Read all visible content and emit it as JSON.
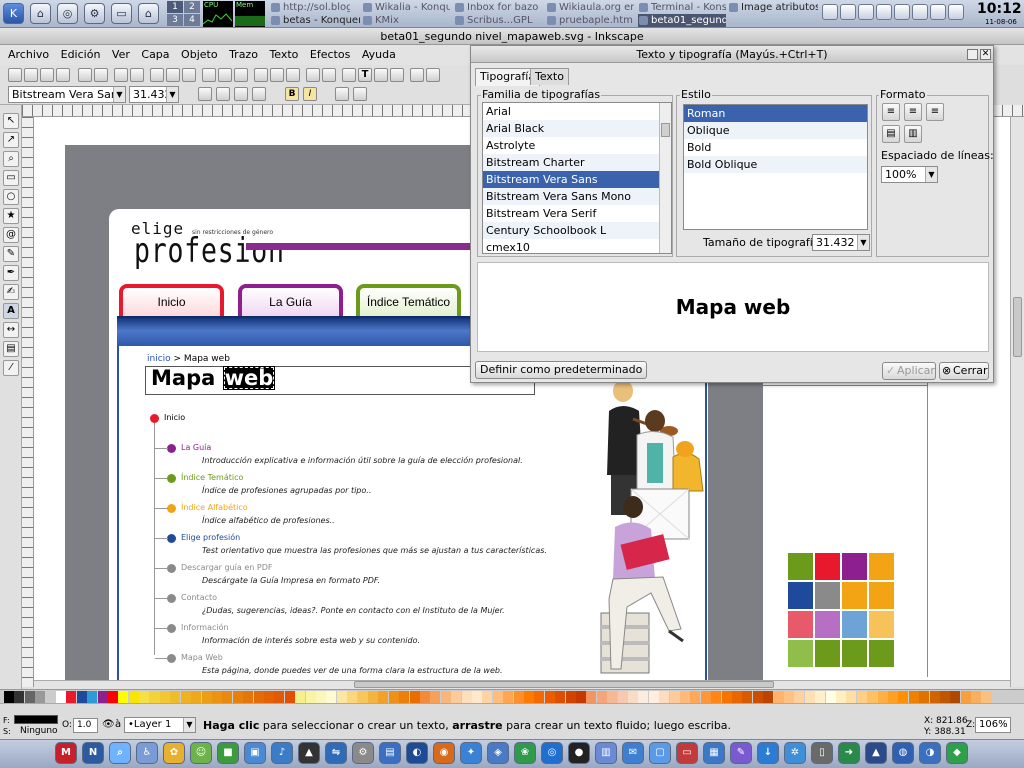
{
  "panel": {
    "tasks": [
      {
        "label": "http://sol.blog",
        "state": "dim"
      },
      {
        "label": "Wikalia - Konqu",
        "state": "dim"
      },
      {
        "label": "Inbox for bazo",
        "state": "dim"
      },
      {
        "label": "Wikiaula.org en",
        "state": "dim"
      },
      {
        "label": "Terminal - Kons",
        "state": "dim"
      },
      {
        "label": "Image atributos",
        "state": "normal"
      },
      {
        "label": "betas - Konquer",
        "state": "normal"
      },
      {
        "label": "KMix",
        "state": "dim"
      },
      {
        "label": "Scribus...GPL",
        "state": "dim"
      },
      {
        "label": "pruebaple.htm",
        "state": "dim"
      },
      {
        "label": "beta01_segundo",
        "state": "active"
      }
    ],
    "monitor_labels": [
      "CPU",
      "Mem"
    ],
    "desktop_numbers": [
      "1",
      "2",
      "3",
      "4"
    ],
    "clock_time": "10:12",
    "clock_date": "11-08-06"
  },
  "window": {
    "title": "beta01_segundo nivel_mapaweb.svg - Inkscape"
  },
  "menus": [
    "Archivo",
    "Edición",
    "Ver",
    "Capa",
    "Objeto",
    "Trazo",
    "Texto",
    "Efectos",
    "Ayuda"
  ],
  "text_toolbar": {
    "font_family": "Bitstream Vera Sans",
    "font_size": "31.432"
  },
  "canvas": {
    "logo_top": "elige",
    "logo_main": "profesion",
    "logo_tagline": "sin restricciones de género",
    "nav_tabs": [
      "Inicio",
      "La Guía",
      "Índice Temático"
    ],
    "breadcrumb_link": "inicio",
    "breadcrumb_rest": " > Mapa web",
    "title_word1": "Mapa",
    "title_word2": "web",
    "tree": [
      {
        "label": "Inicio",
        "color": "#e8192c",
        "desc": ""
      },
      {
        "label": "La Guía",
        "color": "#8e1f8f",
        "desc": "Introducción explicativa e información útil sobre la  guía de elección profesional."
      },
      {
        "label": "Índice Temático",
        "color": "#6c9a1b",
        "desc": "Índice de profesiones agrupadas por tipo.."
      },
      {
        "label": "Índice Alfabético",
        "color": "#f3a415",
        "desc": "Índice alfabético de profesiones.."
      },
      {
        "label": "Elige profesión",
        "color": "#1f4a9c",
        "desc": "Test orientativo que muestra las profesiones que más se ajustan a tus características."
      },
      {
        "label": "Descargar guía en PDF",
        "color": "#8a8a8a",
        "desc": "Descárgate la Guía Impresa en formato PDF."
      },
      {
        "label": "Contacto",
        "color": "#8a8a8a",
        "desc": "¿Dudas, sugerencias, ideas?. Ponte en contacto con el Instituto de la Mujer."
      },
      {
        "label": "Información",
        "color": "#8a8a8a",
        "desc": "Información de interés sobre esta web y su contenido."
      },
      {
        "label": "Mapa Web",
        "color": "#8a8a8a",
        "desc": "Esta página, donde puedes ver de una forma clara la estructura de la web."
      }
    ],
    "squares_colors": [
      "#6c9a1b",
      "#e8192c",
      "#8e1f8f",
      "#f3a415",
      "#1f4a9c",
      "#8a8a8a",
      "#f3a415",
      "#f3a415",
      "#e85a6a",
      "#b76fc5",
      "#6ea3d8",
      "#f7c25a",
      "#8fbf4a",
      "#6c9a1b",
      "#6c9a1b",
      "#6c9a1b"
    ]
  },
  "status": {
    "fill_label": "F:",
    "stroke_label": "S:",
    "stroke_value": "Ninguno",
    "opacity_label": "O:",
    "opacity_value": "1.0",
    "layer": "•Layer 1",
    "msg_b1": "Haga clic",
    "msg_t1": " para seleccionar o crear un texto, ",
    "msg_b2": "arrastre",
    "msg_t2": " para crear un texto fluido; luego escriba.",
    "x_coord": "X: 821.86",
    "y_coord": "Y: 388.31",
    "zoom_label": "Z:",
    "zoom": "106%"
  },
  "dialog": {
    "title": "Texto y tipografía (Mayús.+Ctrl+T)",
    "tabs": [
      "Tipografía",
      "Texto"
    ],
    "family_label": "Familia de tipografías",
    "families": [
      "Arial",
      "Arial Black",
      "Astrolyte",
      "Bitstream Charter",
      "Bitstream Vera Sans",
      "Bitstream Vera Sans Mono",
      "Bitstream Vera Serif",
      "Century Schoolbook L",
      "cmex10"
    ],
    "family_selected": 4,
    "style_label": "Estilo",
    "styles": [
      "Roman",
      "Oblique",
      "Bold",
      "Bold Oblique"
    ],
    "style_selected": 0,
    "size_label": "Tamaño de tipografía:",
    "size_value": "31.432",
    "format_label": "Formato",
    "spacing_label": "Espaciado de líneas:",
    "spacing_value": "100%",
    "preview_text": "Mapa web",
    "default_button": "Definir como predeterminado",
    "apply_button": "Aplicar",
    "close_button": "Cerrar"
  }
}
